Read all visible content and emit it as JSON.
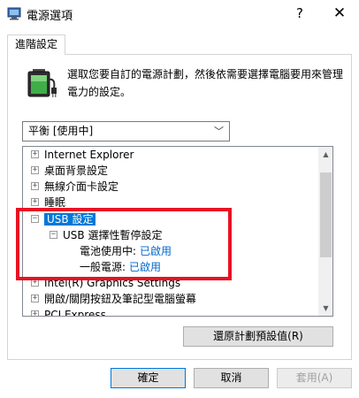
{
  "window": {
    "title": "電源選項",
    "help_glyph": "?",
    "close_glyph": "✕",
    "icon": "power-options-icon"
  },
  "tab": {
    "label": "進階設定"
  },
  "description": {
    "text": "選取您要自訂的電源計劃，然後依需要選擇電腦要用來管理電力的設定。",
    "icon": "battery-icon"
  },
  "plan_select": {
    "value": "平衡 [使用中]",
    "chevron": "﹀"
  },
  "tree": {
    "expander_collapsed": "+",
    "expander_expanded": "−",
    "items": [
      {
        "label": "Internet Explorer"
      },
      {
        "label": "桌面背景設定"
      },
      {
        "label": "無線介面卡設定"
      },
      {
        "label": "睡眠"
      },
      {
        "label": "USB 設定"
      },
      {
        "label": "USB 選擇性暫停設定"
      },
      {
        "label": "電池使用中:",
        "value": "已啟用"
      },
      {
        "label": "一般電源:",
        "value": "已啟用"
      },
      {
        "label": "Intel(R) Graphics Settings"
      },
      {
        "label": "開啟/關閉按鈕及筆記型電腦螢幕"
      },
      {
        "label": "PCI Express"
      }
    ],
    "scroll_up": "▲",
    "scroll_down": "▼"
  },
  "buttons": {
    "restore": "還原計劃預設值(R)",
    "ok": "確定",
    "cancel": "取消",
    "apply": "套用(A)"
  },
  "accent_colors": {
    "selection": "#0078d7",
    "link": "#0066cc",
    "highlight_box": "#e81123"
  }
}
